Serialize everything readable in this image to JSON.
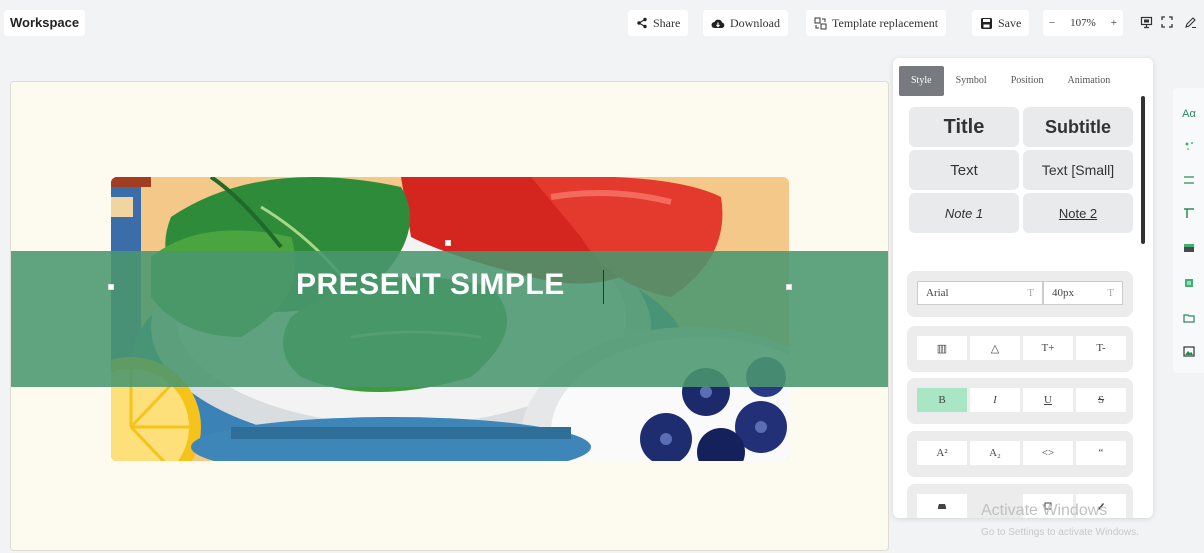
{
  "topbar": {
    "workspace_title": "Workspace",
    "share_label": "Share",
    "download_label": "Download",
    "template_label": "Template replacement",
    "save_label": "Save",
    "zoom_minus": "−",
    "zoom_value": "107%",
    "zoom_plus": "+"
  },
  "canvas": {
    "title_text": "PRESENT SIMPLE",
    "band_color": "#4a966e",
    "background_color": "#fdfbf0"
  },
  "panel": {
    "tabs": [
      "Style",
      "Symbol",
      "Position",
      "Animation"
    ],
    "active_tab": "Style",
    "styles": {
      "title": "Title",
      "subtitle": "Subtitle",
      "text": "Text",
      "text_small": "Text [Small]",
      "note1": "Note 1",
      "note2": "Note 2"
    },
    "font": {
      "family": "Arial",
      "size": "40px"
    },
    "format_row1": [
      "▥",
      "△",
      "T+",
      "T-"
    ],
    "format_row2": [
      "B",
      "I",
      "U",
      "S"
    ],
    "format_row3": [
      "A²",
      "A₂",
      "<>",
      "“"
    ],
    "bold_active_color": "#a8e6c4"
  },
  "strip": {
    "icons": [
      "text-style-icon",
      "sparkle-icon",
      "align-icon",
      "layout-icon",
      "table-icon",
      "list-icon",
      "folder-icon",
      "image-icon"
    ],
    "text_style_label": "Aα"
  },
  "watermark": {
    "title": "Activate Windows",
    "subtitle": "Go to Settings to activate Windows."
  }
}
